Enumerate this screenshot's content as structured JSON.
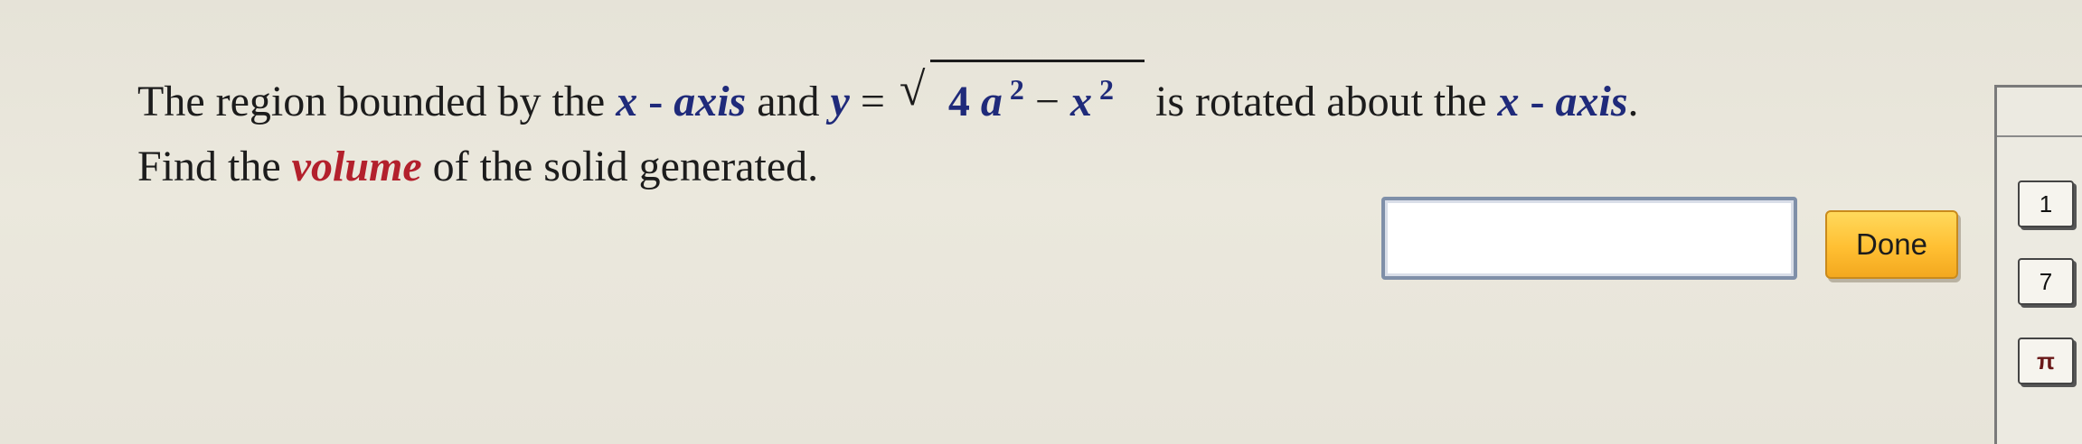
{
  "question": {
    "line1": {
      "t1": "The region bounded by the ",
      "x1": "x",
      "dash1": " - ",
      "axis1": "axis",
      "t2": " and ",
      "y": "y",
      "eq": " = ",
      "sqrt_sign": "√",
      "r_num": "4",
      "r_a": "a",
      "r_exp1": "2",
      "r_minus": " − ",
      "r_x": "x",
      "r_exp2": "2",
      "t3": " is rotated about the ",
      "x2": "x",
      "dash2": " - ",
      "axis2": "axis",
      "t4": "."
    },
    "line2": {
      "t1": "Find the ",
      "volume": "volume",
      "t2": " of the solid generated."
    }
  },
  "answer": {
    "value": ""
  },
  "done_button": {
    "label": "Done"
  },
  "palette": {
    "keys": [
      "1",
      "7",
      "π"
    ]
  },
  "colors": {
    "math_blue": "#1f2a7a",
    "emphasis_red": "#b3202c",
    "done_yellow": "#ffbf32"
  }
}
